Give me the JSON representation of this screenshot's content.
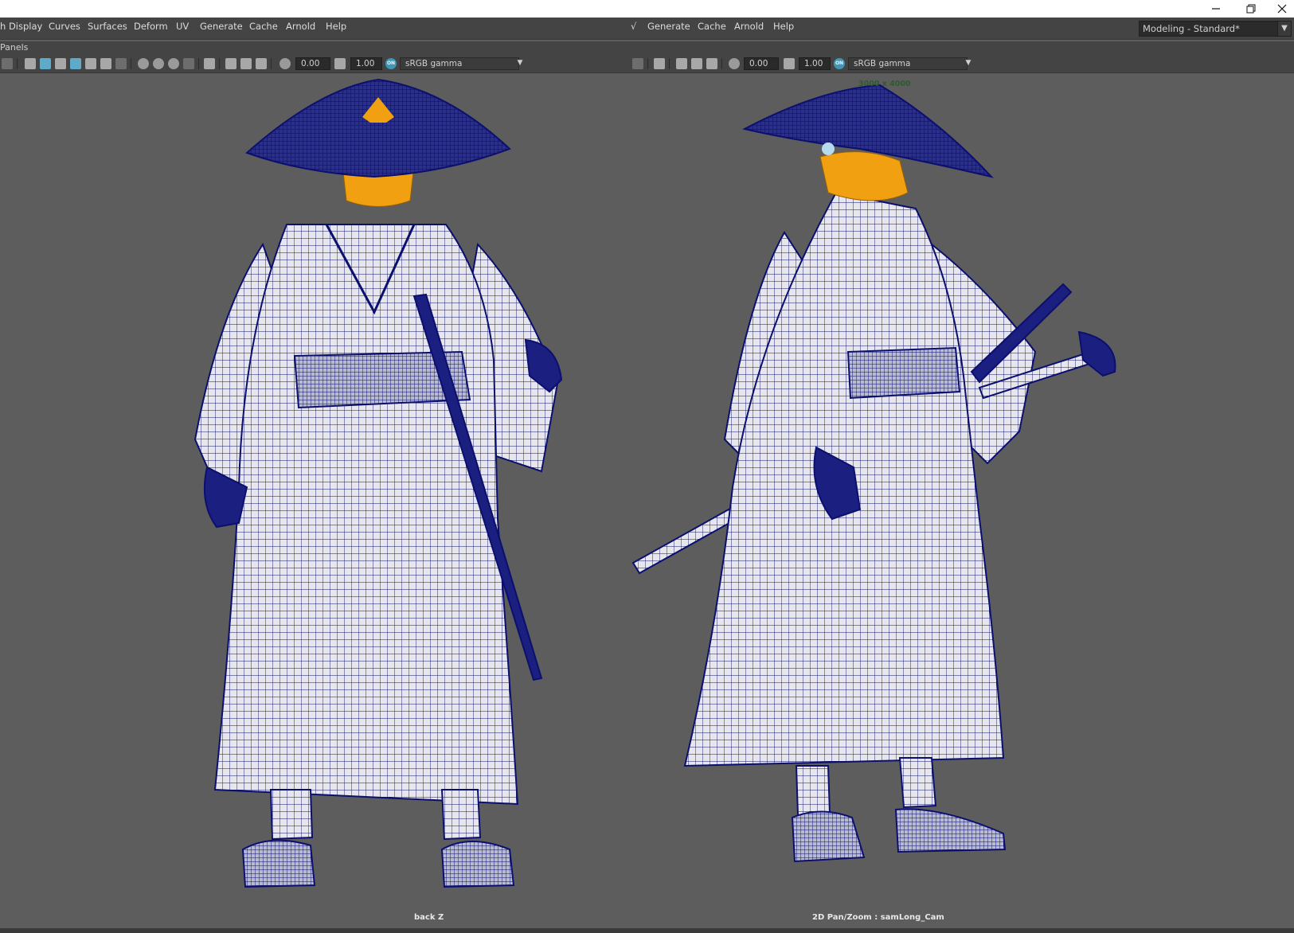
{
  "menubar": {
    "left_items": [
      "h Display",
      "Curves",
      "Surfaces",
      "Deform",
      "UV",
      "Generate",
      "Cache",
      "Arnold",
      "Help"
    ],
    "right_items": [
      "√",
      "Generate",
      "Cache",
      "Arnold",
      "Help"
    ],
    "workspace": "Modeling - Standard*"
  },
  "panels_label": "Panels",
  "viewports": {
    "left": {
      "translate": "0.00",
      "gain": "1.00",
      "colorspace": "sRGB gamma",
      "camera": "back Z"
    },
    "right": {
      "translate": "0.00",
      "gain": "1.00",
      "colorspace": "sRGB gamma",
      "camera": "2D Pan/Zoom : samLong_Cam",
      "resolution": "3000 x 4000"
    }
  },
  "icons": {
    "minimize": "minimize-icon",
    "restore": "restore-icon",
    "close": "close-icon",
    "color_management_badge": "ON"
  },
  "colors": {
    "wireframe": "#0b0f6e",
    "cloth": "#e6e6ec",
    "hair": "#f0a010",
    "viewport_bg": "#5d5d5d"
  }
}
